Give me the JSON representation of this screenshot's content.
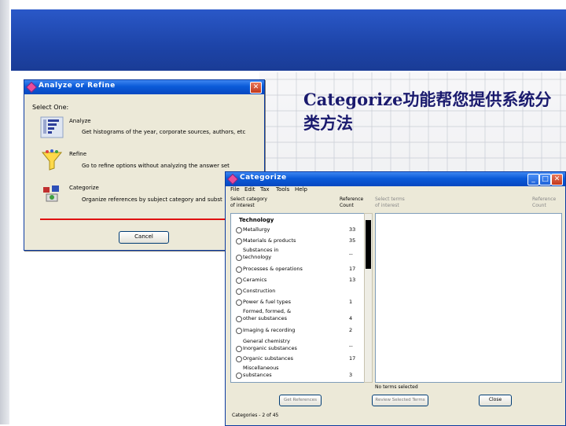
{
  "slide": {
    "title_line1": "Categorize功能帮您提供系统分",
    "title_line2": "类方法"
  },
  "analyze_window": {
    "title": "Analyze or Refine",
    "select_label": "Select One:",
    "options": [
      {
        "icon": "histogram-icon",
        "title": "Analyze",
        "desc": "Get histograms of the year, corporate sources, authors, etc"
      },
      {
        "icon": "funnel-icon",
        "title": "Refine",
        "desc": "Go to refine options without analyzing the answer set"
      },
      {
        "icon": "categorize-icon",
        "title": "Categorize",
        "desc": "Organize references by subject category and subst"
      }
    ],
    "cancel_label": "Cancel"
  },
  "categorize_window": {
    "title": "Categorize",
    "menu": [
      "File",
      "Edit",
      "Tax",
      "Tools",
      "Help"
    ],
    "col1_header_l1": "Select category",
    "col1_header_l2": "of interest",
    "col2_header_l1": "Reference",
    "col2_header_l2": "Count",
    "col3_header_l1": "Select terms",
    "col3_header_l2": "of interest",
    "col4_header_l1": "Reference",
    "col4_header_l2": "Count",
    "group": "Technology",
    "rows": [
      {
        "label1": "Metallurgy",
        "label2": "",
        "count": "33"
      },
      {
        "label1": "Materials & products",
        "label2": "",
        "count": "35"
      },
      {
        "label1": "Substances in",
        "label2": "technology",
        "count": "--"
      },
      {
        "label1": "Processes & operations",
        "label2": "",
        "count": "17"
      },
      {
        "label1": "Ceramics",
        "label2": "",
        "count": "13"
      },
      {
        "label1": "Construction",
        "label2": "",
        "count": ""
      },
      {
        "label1": "Power & fuel types",
        "label2": "",
        "count": "1"
      },
      {
        "label1": "Formed, formed, &",
        "label2": "other substances",
        "count": "4"
      },
      {
        "label1": "Imaging & recording",
        "label2": "",
        "count": "2"
      },
      {
        "label1": "General chemistry",
        "label2": "Inorganic substances",
        "count": "--"
      },
      {
        "label1": "Organic substances",
        "label2": "",
        "count": "17"
      },
      {
        "label1": "Miscellaneous",
        "label2": "substances",
        "count": "3"
      }
    ],
    "status": "No terms selected",
    "buttons": [
      "Get References",
      "Review Selected Terms",
      "Close"
    ],
    "footer": "Categories - 2 of 45"
  },
  "colors": {
    "title_blue": "#1d44a8",
    "xp_titlebar": "#0a5ad8",
    "accent_red": "#e01010"
  }
}
